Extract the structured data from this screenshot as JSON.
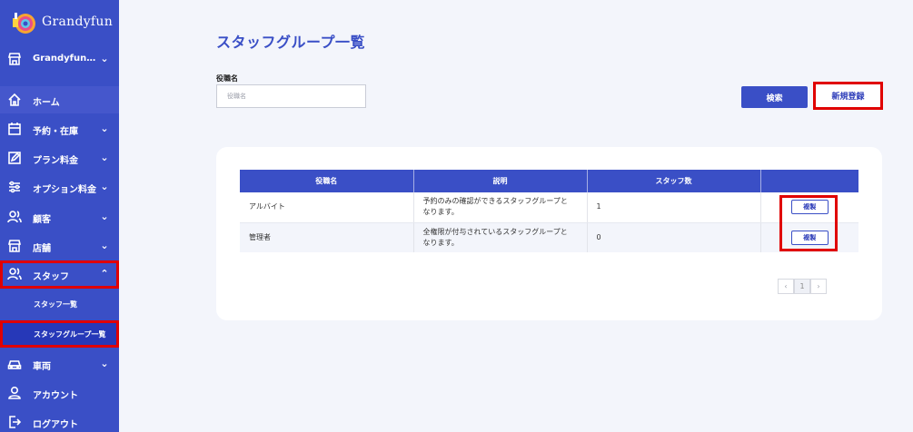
{
  "app": {
    "name": "Grandyfun"
  },
  "sidebar": {
    "store": {
      "label": "Grandyfun…",
      "chevron": "chevron-down"
    },
    "items": [
      {
        "label": "ホーム",
        "icon": "home-icon",
        "chevron": ""
      },
      {
        "label": "予約・在庫",
        "icon": "calendar-icon",
        "chevron": "⌄"
      },
      {
        "label": "プラン料金",
        "icon": "edit-icon",
        "chevron": "⌄"
      },
      {
        "label": "オプション料金",
        "icon": "sliders-icon",
        "chevron": "⌄"
      },
      {
        "label": "顧客",
        "icon": "users-icon",
        "chevron": "⌄"
      },
      {
        "label": "店舗",
        "icon": "store-icon",
        "chevron": "⌄"
      },
      {
        "label": "スタッフ",
        "icon": "staff-icon",
        "chevron": "⌃"
      },
      {
        "label": "車両",
        "icon": "car-icon",
        "chevron": "⌄"
      },
      {
        "label": "アカウント",
        "icon": "account-icon",
        "chevron": ""
      },
      {
        "label": "ログアウト",
        "icon": "logout-icon",
        "chevron": ""
      }
    ],
    "sub_items": [
      {
        "label": "スタッフ一覧"
      },
      {
        "label": "スタッフグループ一覧"
      }
    ]
  },
  "main": {
    "title": "スタッフグループ一覧",
    "filter": {
      "label": "役職名",
      "placeholder": "役職名",
      "value": ""
    },
    "search_button": "検索",
    "new_button": "新規登録",
    "table": {
      "headers": [
        "役職名",
        "説明",
        "スタッフ数",
        ""
      ],
      "rows": [
        {
          "name": "アルバイト",
          "desc_line1": "予約のみの確認ができるスタッフグループと",
          "desc_line2": "なります。",
          "count": "1",
          "action": "複製"
        },
        {
          "name": "管理者",
          "desc_line1": "全権限が付与されているスタッフグループと",
          "desc_line2": "なります。",
          "count": "0",
          "action": "複製"
        }
      ]
    },
    "pagination": {
      "prev": "‹",
      "current": "1",
      "next": "›"
    }
  },
  "colors": {
    "primary": "#3a4fc6",
    "highlight": "#e00000",
    "background": "#f3f5fb"
  }
}
